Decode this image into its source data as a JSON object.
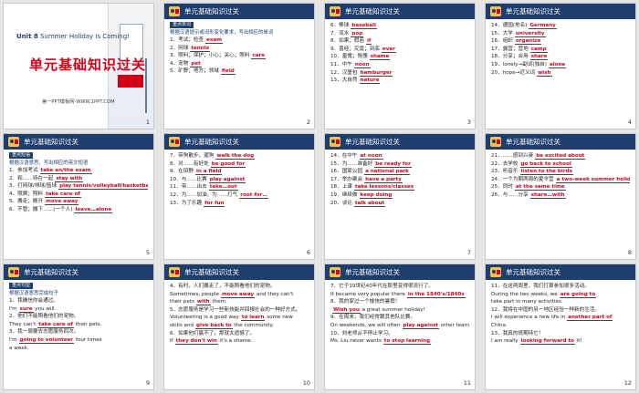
{
  "header_title": "单元基础知识过关",
  "slides": [
    {
      "num": "1",
      "unit_prefix": "Unit 8",
      "unit_title": "Summer Holiday Is Coming!",
      "big_title": "单元基础知识过关",
      "site": "第一PPT模板网-WWW.1PPT.COM"
    },
    {
      "num": "2",
      "tag": "重点单词",
      "hint": "根据汉语提示或词形变化要求，写出相应的单词",
      "lines": [
        {
          "pre": "1．考试；检查",
          "ans": "exam"
        },
        {
          "pre": "2．网球",
          "ans": "tennis"
        },
        {
          "pre": "3．照料；保护；小心；关心；照料",
          "ans": "care"
        },
        {
          "pre": "4．宠物",
          "ans": "pet"
        },
        {
          "pre": "5．矿野；地方；领域",
          "ans": "field"
        }
      ]
    },
    {
      "num": "3",
      "lines": [
        {
          "pre": "6．棒球",
          "ans": "baseball"
        },
        {
          "pre": "7．流水",
          "ans": "pop"
        },
        {
          "pre": "8．如果；假若",
          "ans": "if"
        },
        {
          "pre": "9．曾经；究竟；到底",
          "ans": "ever"
        },
        {
          "pre": "10．羞愧；惭愧",
          "ans": "shame"
        },
        {
          "pre": "11．中午",
          "ans": "noon"
        },
        {
          "pre": "12．汉堡包",
          "ans": "hamburger"
        },
        {
          "pre": "13．大自然",
          "ans": "nature"
        }
      ]
    },
    {
      "num": "4",
      "lines": [
        {
          "pre": "14．德国(地名)",
          "ans": "Germany"
        },
        {
          "pre": "15．大学",
          "ans": "university"
        },
        {
          "pre": "16．组织",
          "ans": "organize"
        },
        {
          "pre": "17．露营；营地",
          "ans": "camp"
        },
        {
          "pre": "18．分享；合用",
          "ans": "share"
        },
        {
          "pre": "19．lonely→副词(独自)",
          "ans": "alone"
        },
        {
          "pre": "20．hope→近义词",
          "ans": "wish"
        }
      ]
    },
    {
      "num": "5",
      "tag": "重点短语",
      "hint": "根据汉语意思，写出相应的英文短语",
      "lines": [
        {
          "pre": "1．参加考试",
          "ans": "take an/the exam"
        },
        {
          "pre": "2．和……待在一起",
          "ans": "stay with"
        },
        {
          "pre": "3．打网球/排球/篮球",
          "ans": "play tennis/volleyball/basketball"
        },
        {
          "pre": "4．照顾；照料",
          "ans": "take care of"
        },
        {
          "pre": "5．搬走；搬开",
          "ans": "move away"
        },
        {
          "pre": "6．不管；撇下……(一个人)",
          "ans": "leave…alone"
        }
      ]
    },
    {
      "num": "6",
      "lines": [
        {
          "pre": "7．带狗散步，遛狗",
          "ans": "walk the dog"
        },
        {
          "pre": "8．对……有好处",
          "ans": "be good for"
        },
        {
          "pre": "9．在田野",
          "ans": "in a field"
        },
        {
          "pre": "10．与……比赛",
          "ans": "play against"
        },
        {
          "pre": "11．带……出去",
          "ans": "take…out"
        },
        {
          "pre": "12．为……加油，为……打气",
          "ans": "root for…"
        },
        {
          "pre": "13．为了乐趣",
          "ans": "for fun"
        }
      ]
    },
    {
      "num": "7",
      "lines": [
        {
          "pre": "14．在中午",
          "ans": "at noon"
        },
        {
          "pre": "15．为……准备好",
          "ans": "be ready for"
        },
        {
          "pre": "16．国家公园",
          "ans": "a national park"
        },
        {
          "pre": "17．举办聚会",
          "ans": "have a party"
        },
        {
          "pre": "18．上课",
          "ans": "take lessons/classes"
        },
        {
          "pre": "19．继续做",
          "ans": "keep doing"
        },
        {
          "pre": "20．谈论",
          "ans": "talk about"
        }
      ]
    },
    {
      "num": "8",
      "lines": [
        {
          "pre": "21．……感到兴奋",
          "ans": "be excited about"
        },
        {
          "pre": "22．去学校",
          "ans": "go back to school"
        },
        {
          "pre": "23．听音乐",
          "ans": "listen to the birds"
        },
        {
          "pre": "24．一个为期两周的夏令营",
          "ans": "a two-week summer holiday"
        },
        {
          "pre": "25．同时",
          "ans": "at the same time"
        },
        {
          "pre": "26．与……分享",
          "ans": "share…with"
        }
      ]
    },
    {
      "num": "9",
      "tag": "重点句型",
      "hint": "根据汉语意思完成句子",
      "lines": [
        {
          "pre": "1．我确信你会通过。",
          "ans": ""
        },
        {
          "pre": "I'm",
          "ans": "sure",
          "post": "you will."
        },
        {
          "pre": "2．他们不能照看他们的宠物。",
          "ans": ""
        },
        {
          "pre": "They can't",
          "ans": "take care of",
          "post": "their pets."
        },
        {
          "pre": "3．我一周要去志愿服务四次。",
          "ans": ""
        },
        {
          "pre": "I'm",
          "ans": "going to volunteer",
          "post": "four times"
        },
        {
          "pre": "a week.",
          "ans": ""
        }
      ]
    },
    {
      "num": "10",
      "lines": [
        {
          "pre": "4．有时，人们搬走了，不能照看他们的宠物。",
          "ans": ""
        },
        {
          "pre": "Sometimes, people",
          "ans": "move away",
          "post": "and they can't"
        },
        {
          "pre": "their pets",
          "ans": "with",
          "post": "them."
        },
        {
          "pre": "5．志愿服务是学习一些新技能并回报社会的一种好方式。",
          "ans": ""
        },
        {
          "pre": "Volunteering is a good way",
          "ans": "to learn",
          "post": "some new"
        },
        {
          "pre": "skills and",
          "ans": "give back to",
          "post": "the community."
        },
        {
          "pre": "6．如果他们赢不了，那就太遗憾了。",
          "ans": ""
        },
        {
          "pre": "If",
          "ans": "they don't win",
          "post": "it's a shame."
        }
      ]
    },
    {
      "num": "11",
      "lines": [
        {
          "pre": "7．它于19世纪40年代在那里变得很流行了。",
          "ans": ""
        },
        {
          "pre": "It became very popular there",
          "ans": "in the 1840's/1840s",
          "post": ""
        },
        {
          "pre": "8．我的家过一个愉快的暑假！",
          "ans": ""
        },
        {
          "pre": "",
          "ans": "Wish you",
          "post": "a great summer holiday!"
        },
        {
          "pre": "9．在周末，我们经常跟其他队比赛。",
          "ans": ""
        },
        {
          "pre": "On weekends, we will often",
          "ans": "play against",
          "post": "other teams."
        },
        {
          "pre": "10．刘老师从不停止学习。",
          "ans": ""
        },
        {
          "pre": "Ms. Liu never wants",
          "ans": "to stop learning",
          "post": ""
        }
      ]
    },
    {
      "num": "12",
      "lines": [
        {
          "pre": "11．在这两周里，我们打算参加很多活动。",
          "ans": ""
        },
        {
          "pre": "During the two weeks, we",
          "ans": "are going to",
          "post": ""
        },
        {
          "pre": "take part in many activities.",
          "ans": ""
        },
        {
          "pre": "12．我将在中国的另一地区经验一种新的生活。",
          "ans": ""
        },
        {
          "pre": "I will experience a new life in",
          "ans": "another part of",
          "post": ""
        },
        {
          "pre": "China.",
          "ans": ""
        },
        {
          "pre": "13．我真的很期待它！",
          "ans": ""
        },
        {
          "pre": "I am really",
          "ans": "looking forward to",
          "post": "it!"
        }
      ]
    }
  ]
}
